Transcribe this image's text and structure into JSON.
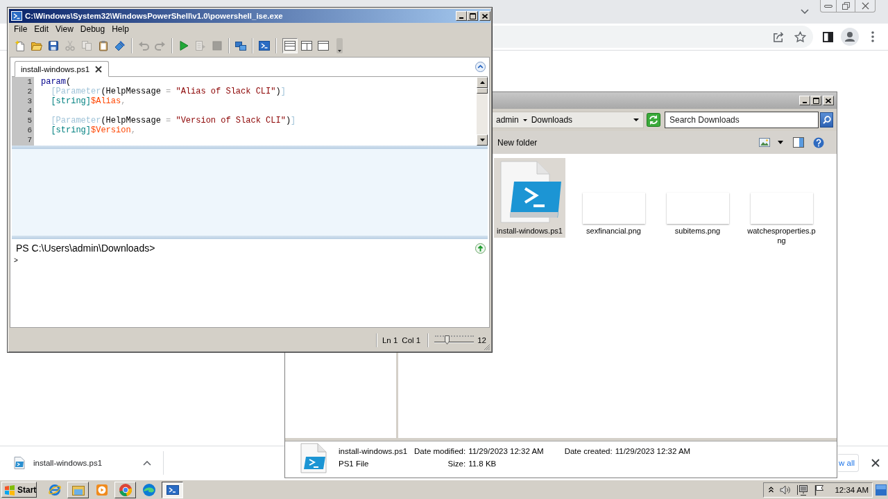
{
  "browser": {
    "download_bar": {
      "file": "install-windows.ps1",
      "show_all": "w all"
    }
  },
  "ise": {
    "title": "C:\\Windows\\System32\\WindowsPowerShell\\v1.0\\powershell_ise.exe",
    "menu": [
      "File",
      "Edit",
      "View",
      "Debug",
      "Help"
    ],
    "toolbar": [
      [
        {
          "kind": "new",
          "disabled": false
        },
        {
          "kind": "open",
          "disabled": false
        },
        {
          "kind": "save",
          "disabled": false
        },
        {
          "kind": "cut",
          "disabled": true
        },
        {
          "kind": "copy",
          "disabled": true
        },
        {
          "kind": "paste",
          "disabled": false
        },
        {
          "kind": "clear",
          "disabled": false
        }
      ],
      [
        {
          "kind": "undo",
          "disabled": true
        },
        {
          "kind": "redo",
          "disabled": true
        }
      ],
      [
        {
          "kind": "run",
          "disabled": false
        },
        {
          "kind": "run-selection",
          "disabled": true
        },
        {
          "kind": "stop",
          "disabled": true
        }
      ],
      [
        {
          "kind": "remote",
          "disabled": false
        }
      ],
      [
        {
          "kind": "console",
          "disabled": false
        }
      ]
    ],
    "layouts": [
      {
        "kind": "top",
        "selected": true
      },
      {
        "kind": "right",
        "selected": false
      },
      {
        "kind": "maximized",
        "selected": false
      }
    ],
    "tab": "install-windows.ps1",
    "lines": [
      {
        "number": "1",
        "tokens": [
          {
            "kind": "keyword",
            "text": "param"
          },
          {
            "kind": "plain",
            "text": "("
          }
        ]
      },
      {
        "number": "2",
        "tokens": [
          {
            "kind": "attribute",
            "text": "  [Parameter"
          },
          {
            "kind": "plain",
            "text": "(HelpMessage"
          },
          {
            "kind": "operator",
            "text": " = "
          },
          {
            "kind": "string",
            "text": "\"Alias of Slack CLI\""
          },
          {
            "kind": "plain",
            "text": ")"
          },
          {
            "kind": "attribute",
            "text": "]"
          }
        ]
      },
      {
        "number": "3",
        "tokens": [
          {
            "kind": "type",
            "text": "  [string]"
          },
          {
            "kind": "variable",
            "text": "$Alias"
          },
          {
            "kind": "operator",
            "text": ","
          }
        ]
      },
      {
        "number": "4"
      },
      {
        "number": "5",
        "tokens": [
          {
            "kind": "attribute",
            "text": "  [Parameter"
          },
          {
            "kind": "plain",
            "text": "(HelpMessage"
          },
          {
            "kind": "operator",
            "text": " = "
          },
          {
            "kind": "string",
            "text": "\"Version of Slack CLI\""
          },
          {
            "kind": "plain",
            "text": ")"
          },
          {
            "kind": "attribute",
            "text": "]"
          }
        ]
      },
      {
        "number": "6",
        "tokens": [
          {
            "kind": "type",
            "text": "  [string]"
          },
          {
            "kind": "variable",
            "text": "$Version"
          },
          {
            "kind": "operator",
            "text": ","
          }
        ]
      },
      {
        "number": "7"
      }
    ],
    "prompt": "PS C:\\Users\\admin\\Downloads>",
    "input": ">",
    "status": {
      "line": "Ln 1",
      "column": "Col 1",
      "zoom": {
        "level": 0.33,
        "reading": "12"
      }
    }
  },
  "explorer": {
    "path": [
      "admin",
      "Downloads"
    ],
    "search": {
      "placeholder": "Search Downloads"
    },
    "new_folder": "New folder",
    "files": [
      {
        "name": "install-windows.ps1",
        "kind": "script",
        "selected": true
      },
      {
        "name": "sexfinancial.png",
        "kind": "image",
        "selected": false
      },
      {
        "name": "subitems.png",
        "kind": "image",
        "selected": false
      },
      {
        "name": "watchesproperties.png",
        "kind": "image",
        "selected": false
      }
    ],
    "details": {
      "name": "install-windows.ps1",
      "type": "PS1 File",
      "date_modified": {
        "label": "Date modified:",
        "value": "11/29/2023 12:32 AM"
      },
      "size": {
        "label": "Size:",
        "value": "11.8 KB"
      },
      "date_created": {
        "label": "Date created:",
        "value": "11/29/2023 12:32 AM"
      }
    }
  },
  "taskbar": {
    "start": "Start",
    "apps": [
      {
        "kind": "ie",
        "open": false,
        "selected": false
      },
      {
        "kind": "explorer",
        "open": true,
        "selected": false
      },
      {
        "kind": "media",
        "open": false,
        "selected": false
      },
      {
        "kind": "chrome",
        "open": true,
        "selected": false
      },
      {
        "kind": "edge",
        "open": false,
        "selected": false
      },
      {
        "kind": "ise",
        "open": true,
        "selected": true
      }
    ],
    "clock": "12:34 AM"
  }
}
